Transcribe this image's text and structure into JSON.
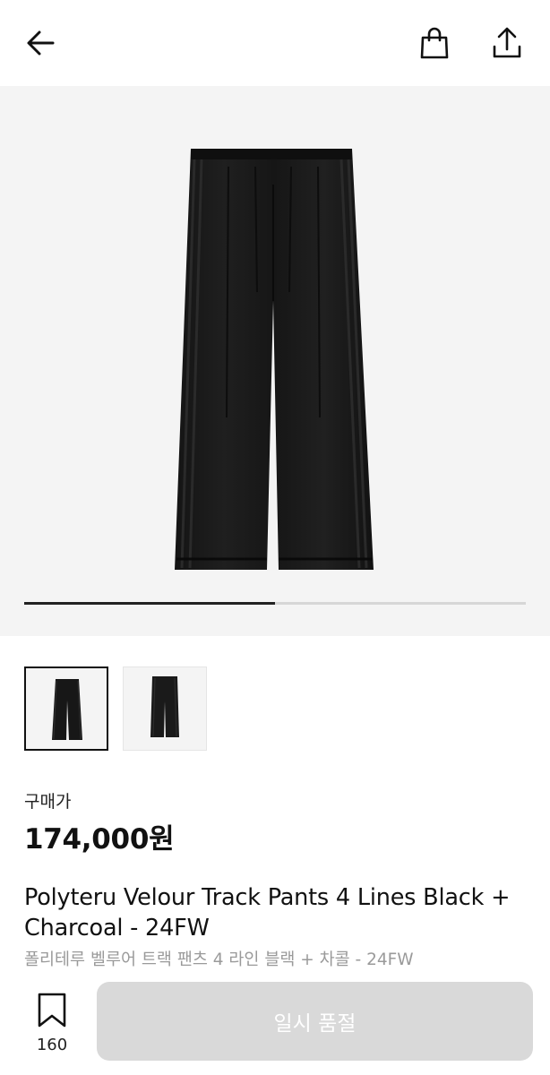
{
  "header": {
    "back_icon": "arrow-left-icon",
    "cart_icon": "shopping-bag-icon",
    "share_icon": "share-icon"
  },
  "gallery": {
    "current_image": 1,
    "total_images": 2,
    "progress": 0.5
  },
  "product": {
    "price_label": "구매가",
    "price": "174,000원",
    "title_en": "Polyteru Velour Track Pants 4 Lines Black + Charcoal - 24FW",
    "title_ko": "폴리테루 벨루어 트랙 팬츠 4 라인 블랙 + 차콜 - 24FW"
  },
  "bottom_bar": {
    "bookmark_icon": "bookmark-icon",
    "bookmark_count": "160",
    "buy_label": "일시 품절"
  },
  "colors": {
    "accent": "#111111",
    "disabled_button": "#d9d9d9",
    "muted_text": "#9a9a9a",
    "gallery_bg": "#f4f4f4"
  }
}
